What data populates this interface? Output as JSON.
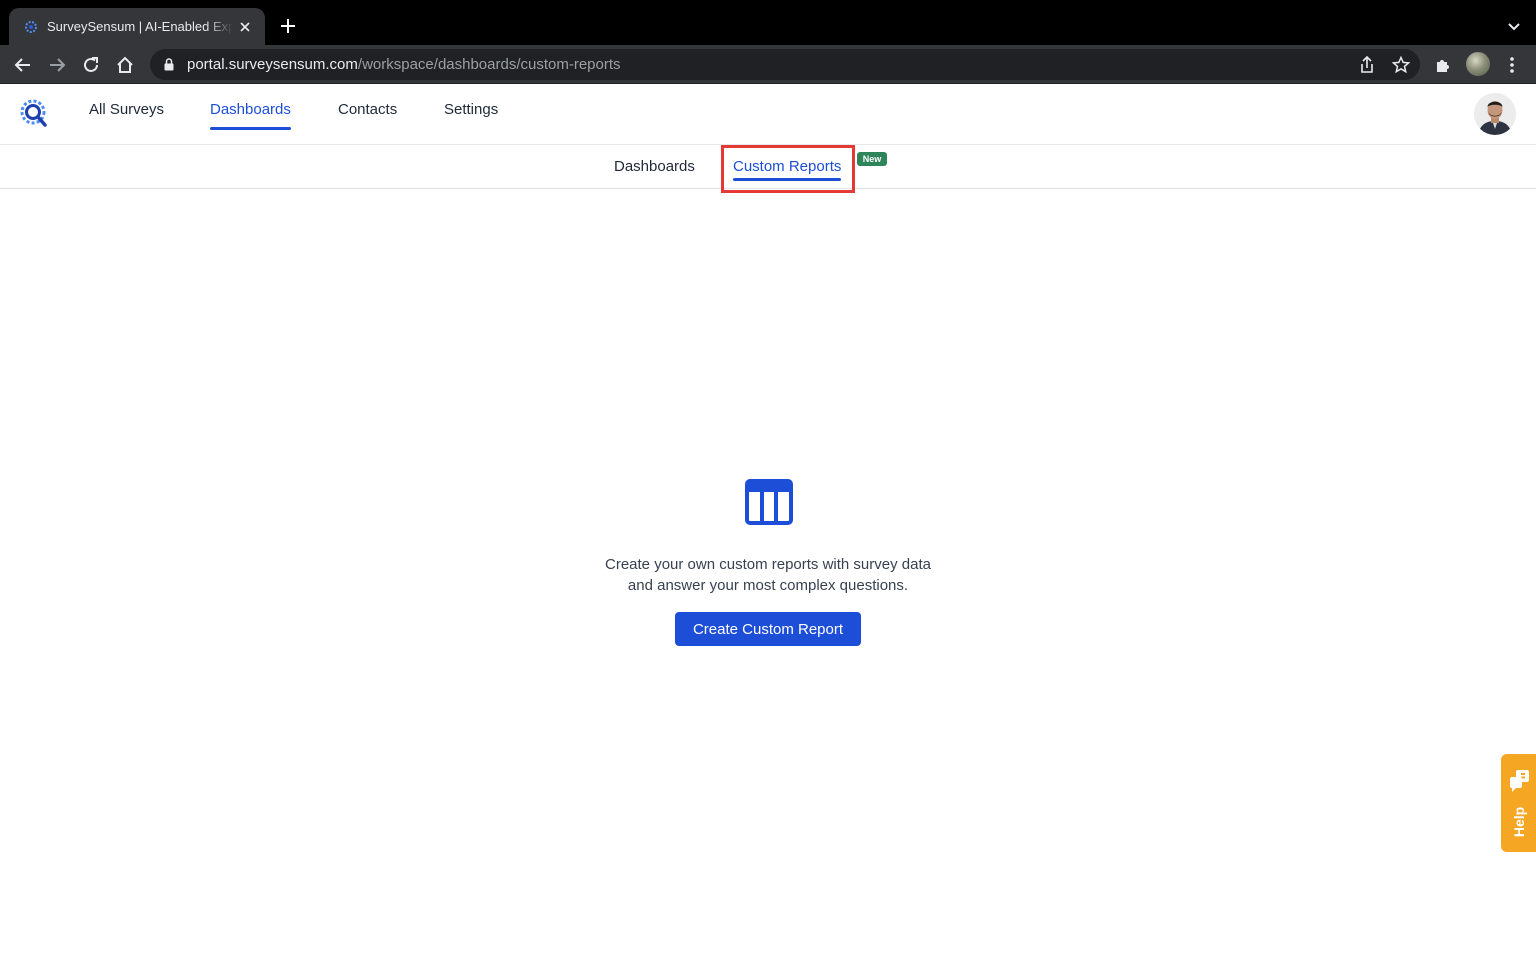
{
  "browser": {
    "tab_title": "SurveySensum | AI-Enabled Experience Management",
    "url_host": "portal.surveysensum.com",
    "url_path": "/workspace/dashboards/custom-reports"
  },
  "nav": {
    "items": [
      "All Surveys",
      "Dashboards",
      "Contacts",
      "Settings"
    ],
    "active": "Dashboards"
  },
  "subnav": {
    "tabs": [
      "Dashboards",
      "Custom Reports"
    ],
    "active": "Custom Reports",
    "new_badge": "New"
  },
  "empty_state": {
    "line1": "Create your own custom reports with survey data",
    "line2": "and answer your most complex questions.",
    "button_label": "Create Custom Report",
    "icon": "table-icon"
  },
  "help": {
    "label": "Help"
  },
  "colors": {
    "accent": "#1d4ed8",
    "highlight": "#e53935",
    "new_badge": "#2f855a",
    "help_widget": "#f5a623"
  }
}
